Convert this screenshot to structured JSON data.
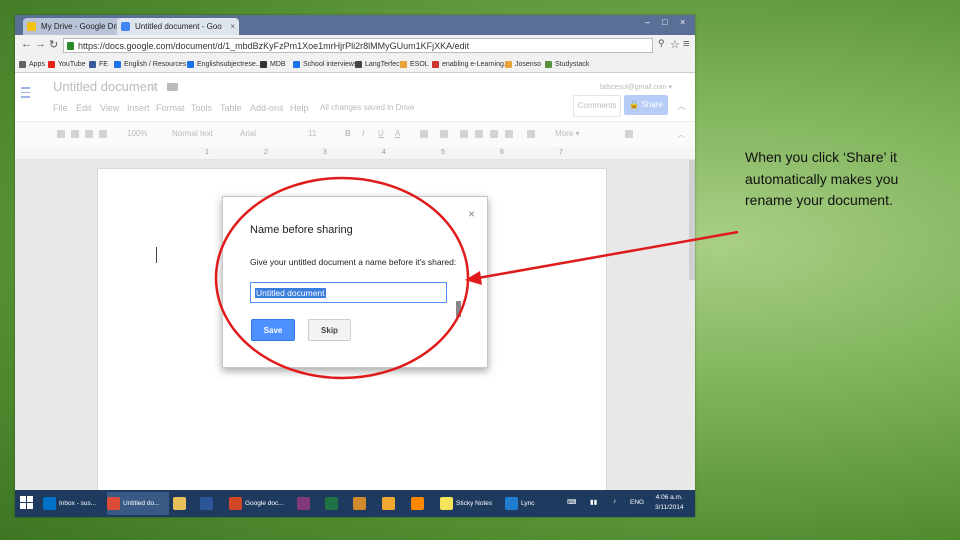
{
  "browser": {
    "tabs": [
      {
        "label": "My Drive - Google Drive",
        "icon": "google-drive-icon"
      },
      {
        "label": "Untitled document - Goo",
        "icon": "google-docs-icon"
      }
    ],
    "close_glyph": "×",
    "window_controls": [
      "–",
      "□",
      "×"
    ],
    "url": "https://docs.google.com/document/d/1_mbdBzKyFzPm1Xoe1mrHjrPli2r8lMMyGUum1KFjXKA/edit",
    "bookmarks": [
      {
        "label": "Apps",
        "color": "#5f6368"
      },
      {
        "label": "YouTube",
        "color": "#e62117"
      },
      {
        "label": "FE",
        "color": "#3b5998"
      },
      {
        "label": "English / Resources ...",
        "color": "#1a73e8"
      },
      {
        "label": "Englishsubjectrese...",
        "color": "#1a73e8"
      },
      {
        "label": "MDB",
        "color": "#333333"
      },
      {
        "label": "School interviews",
        "color": "#1a73e8"
      },
      {
        "label": "LangTerfect",
        "color": "#444444"
      },
      {
        "label": "ESOL",
        "color": "#e8a33b"
      },
      {
        "label": "enabling e-Learning...",
        "color": "#cc3333"
      },
      {
        "label": "Josenso",
        "color": "#e8a33b"
      },
      {
        "label": "Studystack",
        "color": "#5a8f3e"
      }
    ]
  },
  "docs": {
    "title": "Untitled document",
    "star": "☆",
    "menu": [
      "File",
      "Edit",
      "View",
      "Insert",
      "Format",
      "Tools",
      "Table",
      "Add-ons",
      "Help"
    ],
    "save_status": "All changes saved in Drive",
    "account": "bdscesol@gmail.com ▾",
    "comments_label": "Comments",
    "share_label": "Share",
    "collapse": "︿",
    "toolbar": {
      "zoom": "100%",
      "style": "Normal text",
      "font": "Arial",
      "size": "11",
      "bold": "B",
      "italic": "I",
      "underline": "U",
      "text_color": "A",
      "more": "More ▾"
    },
    "ruler_numbers": [
      "1",
      "2",
      "3",
      "4",
      "5",
      "6",
      "7"
    ]
  },
  "dialog": {
    "title": "Name before sharing",
    "close": "×",
    "prompt": "Give your untitled document a name before it's shared:",
    "input_value": "Untitled document",
    "save_label": "Save",
    "skip_label": "Skip"
  },
  "taskbar": {
    "items": [
      {
        "label": "Inbox - sus...",
        "color": "#0072c6"
      },
      {
        "label": "Untitled do...",
        "color": "#dd4b39"
      },
      {
        "label": "",
        "color": "#e8c15a"
      },
      {
        "label": "",
        "color": "#2b579a"
      },
      {
        "label": "Google doc...",
        "color": "#d24726"
      },
      {
        "label": "",
        "color": "#80397b"
      },
      {
        "label": "",
        "color": "#217346"
      },
      {
        "label": "",
        "color": "#d38a2c"
      },
      {
        "label": "",
        "color": "#f0a830"
      },
      {
        "label": "",
        "color": "#ff8800"
      },
      {
        "label": "Sticky Notes",
        "color": "#f5e35c"
      },
      {
        "label": "Lync",
        "color": "#1f7ed0"
      }
    ],
    "tray": "ENG",
    "time": "4:06 a.m.",
    "date": "3/11/2014"
  },
  "callout": {
    "text": "When you click ‘Share’ it automatically makes you rename your document."
  },
  "colors": {
    "annotation_red": "#e01b1b",
    "share_blue": "#4d90fe"
  }
}
